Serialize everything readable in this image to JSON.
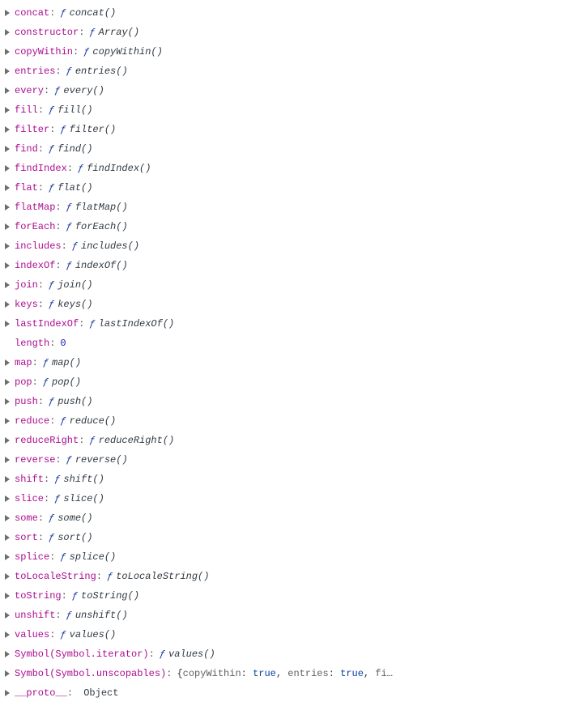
{
  "colon": ":",
  "fsymbol": "ƒ",
  "props": [
    {
      "name": "concat",
      "disp": "concat()",
      "kind": "fn"
    },
    {
      "name": "constructor",
      "disp": "Array()",
      "kind": "fn"
    },
    {
      "name": "copyWithin",
      "disp": "copyWithin()",
      "kind": "fn"
    },
    {
      "name": "entries",
      "disp": "entries()",
      "kind": "fn"
    },
    {
      "name": "every",
      "disp": "every()",
      "kind": "fn"
    },
    {
      "name": "fill",
      "disp": "fill()",
      "kind": "fn"
    },
    {
      "name": "filter",
      "disp": "filter()",
      "kind": "fn"
    },
    {
      "name": "find",
      "disp": "find()",
      "kind": "fn"
    },
    {
      "name": "findIndex",
      "disp": "findIndex()",
      "kind": "fn"
    },
    {
      "name": "flat",
      "disp": "flat()",
      "kind": "fn"
    },
    {
      "name": "flatMap",
      "disp": "flatMap()",
      "kind": "fn"
    },
    {
      "name": "forEach",
      "disp": "forEach()",
      "kind": "fn"
    },
    {
      "name": "includes",
      "disp": "includes()",
      "kind": "fn"
    },
    {
      "name": "indexOf",
      "disp": "indexOf()",
      "kind": "fn"
    },
    {
      "name": "join",
      "disp": "join()",
      "kind": "fn"
    },
    {
      "name": "keys",
      "disp": "keys()",
      "kind": "fn"
    },
    {
      "name": "lastIndexOf",
      "disp": "lastIndexOf()",
      "kind": "fn"
    },
    {
      "name": "length",
      "disp": "0",
      "kind": "val"
    },
    {
      "name": "map",
      "disp": "map()",
      "kind": "fn"
    },
    {
      "name": "pop",
      "disp": "pop()",
      "kind": "fn"
    },
    {
      "name": "push",
      "disp": "push()",
      "kind": "fn"
    },
    {
      "name": "reduce",
      "disp": "reduce()",
      "kind": "fn"
    },
    {
      "name": "reduceRight",
      "disp": "reduceRight()",
      "kind": "fn"
    },
    {
      "name": "reverse",
      "disp": "reverse()",
      "kind": "fn"
    },
    {
      "name": "shift",
      "disp": "shift()",
      "kind": "fn"
    },
    {
      "name": "slice",
      "disp": "slice()",
      "kind": "fn"
    },
    {
      "name": "some",
      "disp": "some()",
      "kind": "fn"
    },
    {
      "name": "sort",
      "disp": "sort()",
      "kind": "fn"
    },
    {
      "name": "splice",
      "disp": "splice()",
      "kind": "fn"
    },
    {
      "name": "toLocaleString",
      "disp": "toLocaleString()",
      "kind": "fn"
    },
    {
      "name": "toString",
      "disp": "toString()",
      "kind": "fn"
    },
    {
      "name": "unshift",
      "disp": "unshift()",
      "kind": "fn"
    },
    {
      "name": "values",
      "disp": "values()",
      "kind": "fn"
    },
    {
      "name": "Symbol(Symbol.iterator)",
      "disp": "values()",
      "kind": "fn"
    },
    {
      "name": "Symbol(Symbol.unscopables)",
      "disp": "{copyWithin: true, entries: true, fi…",
      "kind": "objspecial"
    },
    {
      "name": "__proto__",
      "disp": "Object",
      "kind": "plain"
    }
  ],
  "special": {
    "brace_open": "{",
    "p1": "copyWithin",
    "p1v": "true",
    "p2": "entries",
    "p2v": "true",
    "p3pre": "fi",
    "ell": "…",
    "sep": ", "
  }
}
